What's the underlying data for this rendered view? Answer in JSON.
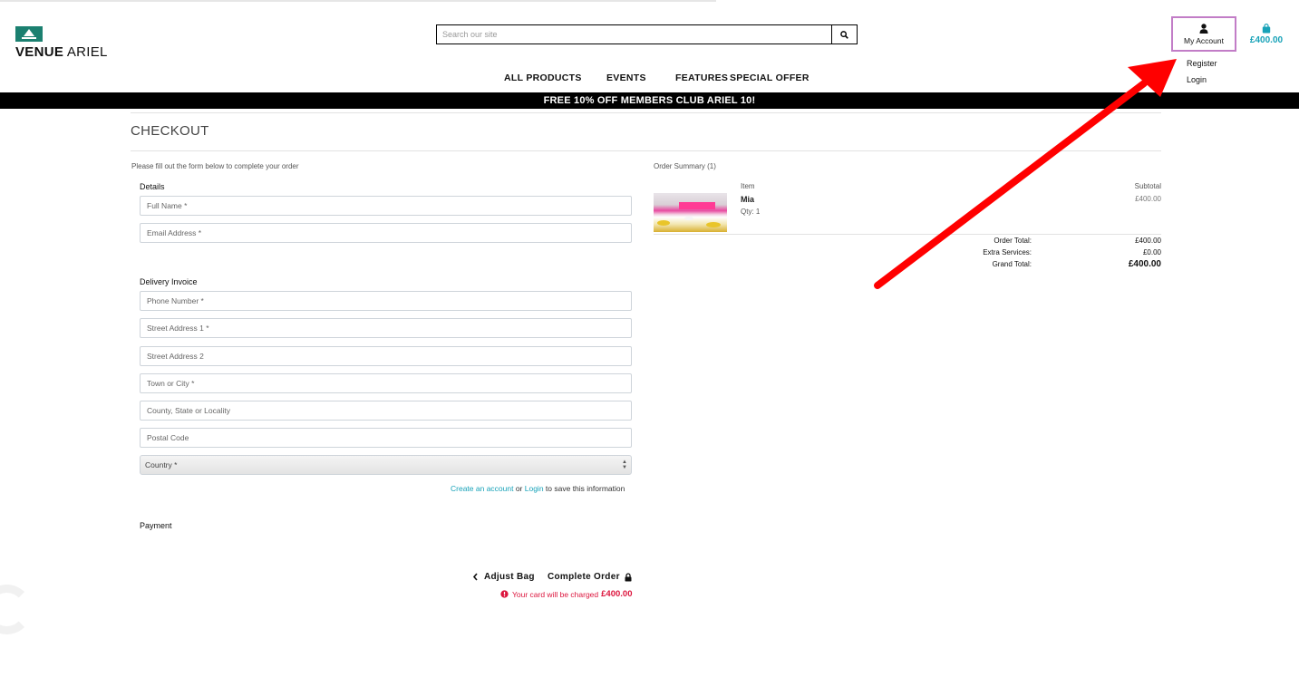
{
  "brand": {
    "name_bold": "VENUE",
    "name_rest": " ARIEL",
    "logo_color": "#1b8070"
  },
  "search": {
    "placeholder": "Search our site",
    "icon": "search-icon"
  },
  "nav": {
    "items": [
      "ALL PRODUCTS",
      "EVENTS",
      "FEATURES",
      "SPECIAL OFFER"
    ]
  },
  "account": {
    "label": "My Account",
    "icon": "user-icon",
    "highlight_color": "#c27dc7",
    "menu": [
      "Register",
      "Login"
    ]
  },
  "bag": {
    "icon": "shopping-bag-icon",
    "amount": "£400.00",
    "color": "#17a2b8"
  },
  "banner": {
    "text": "FREE 10% OFF MEMBERS CLUB ARIEL 10!"
  },
  "checkout": {
    "title": "CHECKOUT",
    "intro": "Please fill out the form below to complete your order",
    "details_label": "Details",
    "details_fields": [
      "Full Name *",
      "Email Address *"
    ],
    "delivery_label": "Delivery Invoice",
    "delivery_fields": [
      "Phone Number *",
      "Street Address 1 *",
      "Street Address 2",
      "Town or City *",
      "County, State or Locality",
      "Postal Code"
    ],
    "country_placeholder": "Country *",
    "save_info": {
      "create_link": "Create an account",
      "or": " or ",
      "login_link": "Login",
      "suffix": " to save this information"
    },
    "payment_label": "Payment"
  },
  "summary": {
    "title": "Order Summary (1)",
    "col_item": "Item",
    "col_subtotal": "Subtotal",
    "item_name": "Mia",
    "item_qty": "Qty: 1",
    "item_subtotal": "£400.00",
    "order_total_label": "Order Total:",
    "order_total": "£400.00",
    "extra_label": "Extra Services:",
    "extra": "£0.00",
    "grand_label": "Grand Total:",
    "grand": "£400.00"
  },
  "actions": {
    "adjust_label": "Adjust Bag",
    "complete_label": "Complete Order",
    "charge_text": "Your card will be charged",
    "charge_amount": "£400.00",
    "charge_color": "#dc143c"
  },
  "annotation": {
    "arrow_color": "#ff0000"
  }
}
